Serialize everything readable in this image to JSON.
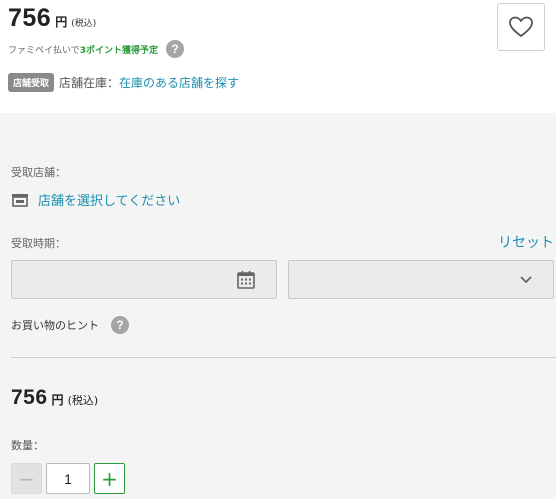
{
  "product": {
    "price": "756",
    "yen": "円",
    "tax": "(税込)",
    "points_prefix": "ファミペイ払いで",
    "points_highlight": "3ポイント獲得予定",
    "help_mark": "?"
  },
  "pickup": {
    "badge": "店舗受取",
    "stock_label": "店舗在庫：",
    "stock_link": "在庫のある店舗を探す"
  },
  "form": {
    "store_label": "受取店舗：",
    "store_link": "店舗を選択してください",
    "date_label": "受取時期：",
    "reset": "リセット",
    "hint": "お買い物のヒント",
    "hint_mark": "?"
  },
  "summary": {
    "price": "756",
    "yen": "円",
    "tax": "(税込)"
  },
  "quantity": {
    "label": "数量：",
    "value": "1",
    "minus": "−",
    "plus": "+"
  },
  "colors": {
    "accent_green": "#2a9a3a",
    "link_blue": "#1a8fb0",
    "badge_grey": "#8a8a8a",
    "panel_bg": "#f4f4f4"
  },
  "icons": [
    "heart-icon",
    "question-icon",
    "store-icon",
    "calendar-icon",
    "chevron-down-icon"
  ]
}
